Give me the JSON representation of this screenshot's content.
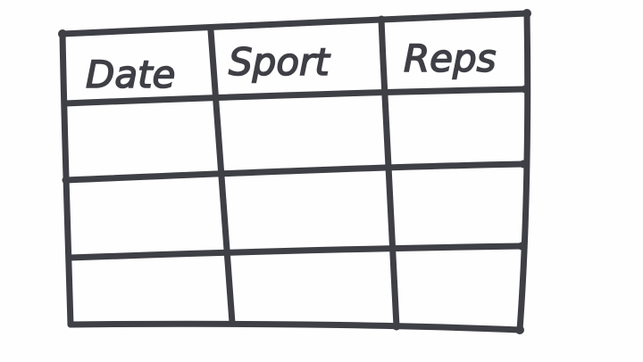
{
  "table": {
    "headers": [
      "Date",
      "Sport",
      "Reps"
    ],
    "rows": [
      [
        "",
        "",
        ""
      ],
      [
        "",
        "",
        ""
      ],
      [
        "",
        "",
        ""
      ]
    ]
  },
  "colors": {
    "ink": "#3f3f46",
    "paper": "#fefefe"
  }
}
